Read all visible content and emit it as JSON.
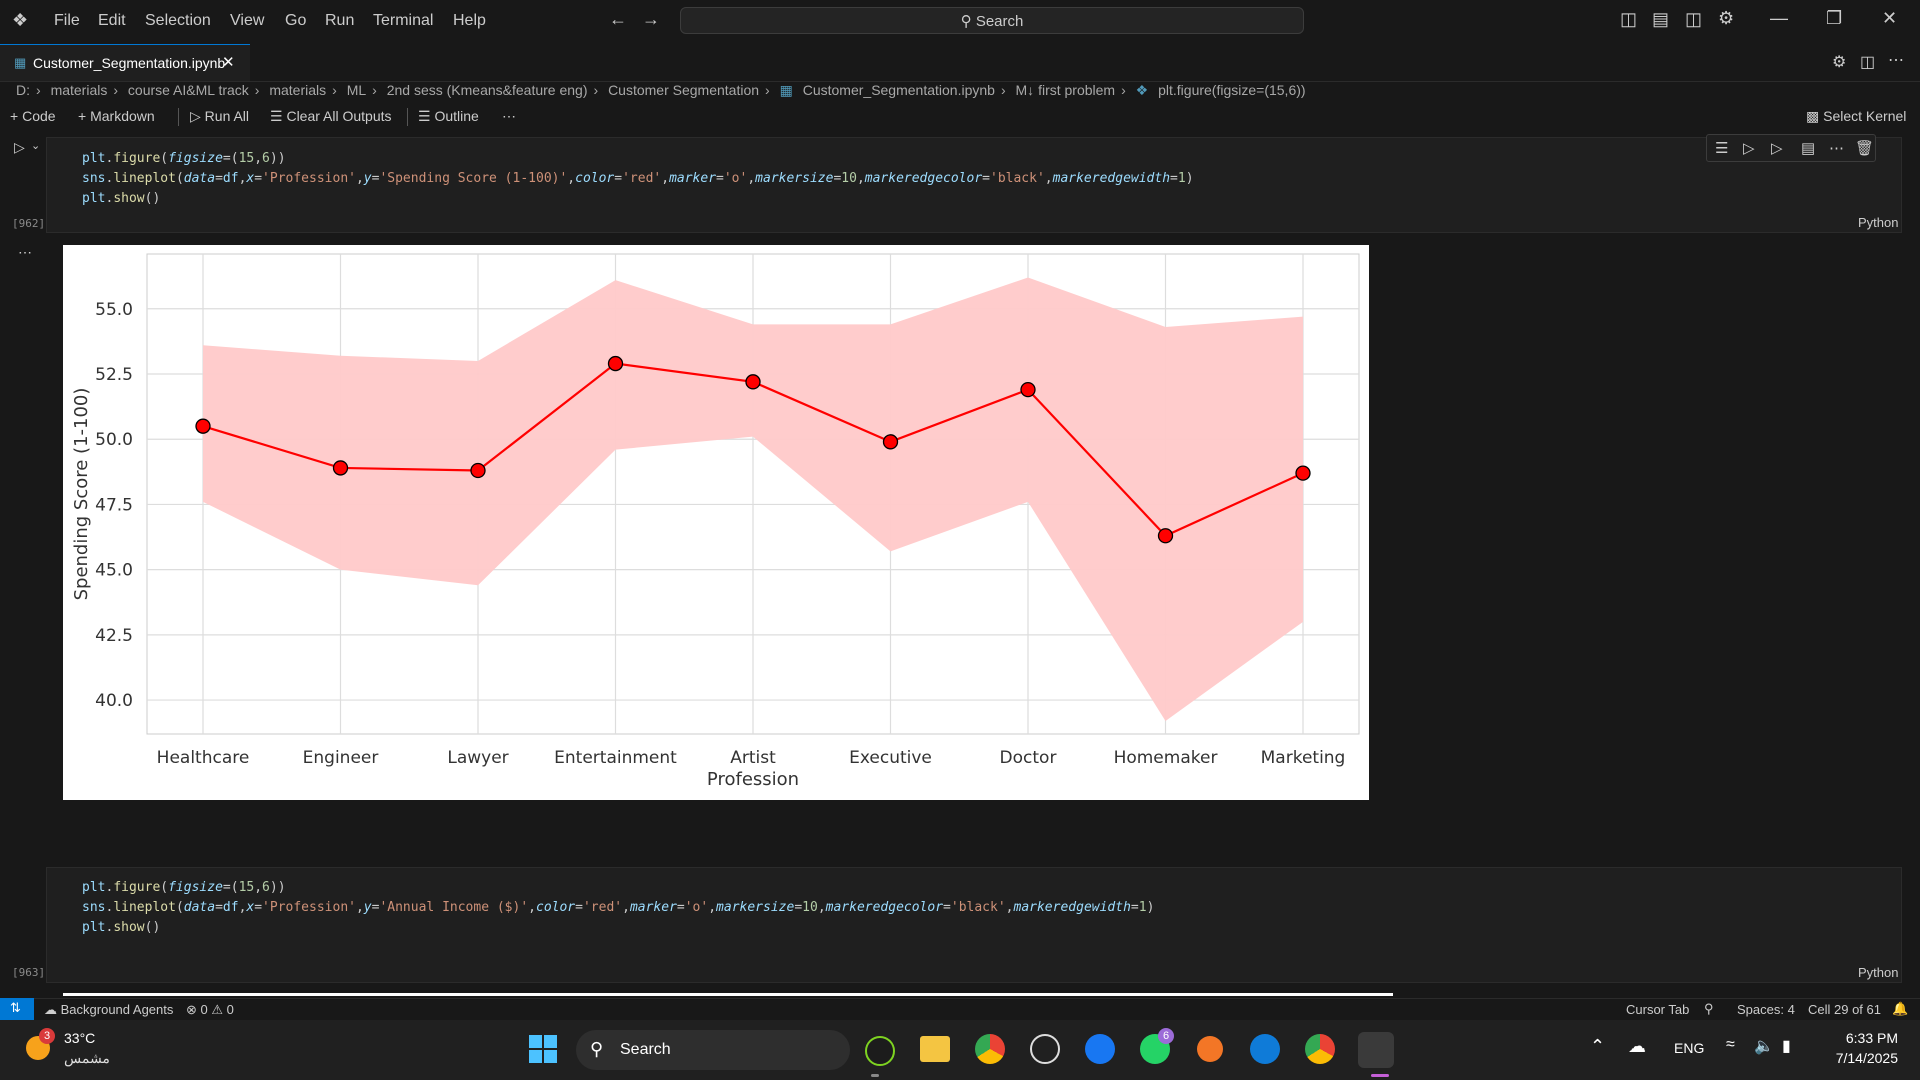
{
  "menu": [
    "File",
    "Edit",
    "Selection",
    "View",
    "Go",
    "Run",
    "Terminal",
    "Help"
  ],
  "search": {
    "label": "Search"
  },
  "tab": {
    "title": "Customer_Segmentation.ipynb"
  },
  "breadcrumb": [
    "D:",
    "materials",
    "course AI&ML track",
    "materials",
    "ML",
    "2nd sess (Kmeans&feature eng)",
    "Customer Segmentation",
    "Customer_Segmentation.ipynb",
    "M↓ first problem",
    "plt.figure(figsize=(15,6))"
  ],
  "toolbar": {
    "code": "Code",
    "markdown": "Markdown",
    "run_all": "Run All",
    "clear": "Clear All Outputs",
    "outline": "Outline",
    "kernel": "Select Kernel"
  },
  "cells": [
    {
      "count": "[962]",
      "lang": "Python"
    },
    {
      "count": "[963]",
      "lang": "Python"
    }
  ],
  "chart_data": {
    "type": "line",
    "categories": [
      "Healthcare",
      "Engineer",
      "Lawyer",
      "Entertainment",
      "Artist",
      "Executive",
      "Doctor",
      "Homemaker",
      "Marketing"
    ],
    "values": [
      50.5,
      48.9,
      48.8,
      52.9,
      52.2,
      49.9,
      51.9,
      46.3,
      48.7
    ],
    "ci_low": [
      47.6,
      45.0,
      44.4,
      49.6,
      50.1,
      45.7,
      47.6,
      39.2,
      43.0
    ],
    "ci_high": [
      53.6,
      53.2,
      53.0,
      56.1,
      54.4,
      54.4,
      56.2,
      54.3,
      54.7
    ],
    "xlabel": "Profession",
    "ylabel": "Spending Score (1-100)",
    "yticks": [
      "40.0",
      "42.5",
      "45.0",
      "47.5",
      "50.0",
      "52.5",
      "55.0"
    ],
    "ylim": [
      38.7,
      57.1
    ],
    "color": "#ff0000",
    "fill": "#ffc9c9",
    "marker_edge": "#000000",
    "grid": true
  },
  "status": {
    "agents": "Background Agents",
    "problems": "⊗ 0 ⚠ 0",
    "cursor_tab": "Cursor Tab",
    "spaces": "Spaces: 4",
    "cell": "Cell 29 of 61"
  },
  "taskbar": {
    "temp": "33°C",
    "weather": "مشمس",
    "badge": "3",
    "search": "Search",
    "lang": "ENG",
    "time": "6:33 PM",
    "date": "7/14/2025",
    "whatsapp_badge": "6"
  }
}
